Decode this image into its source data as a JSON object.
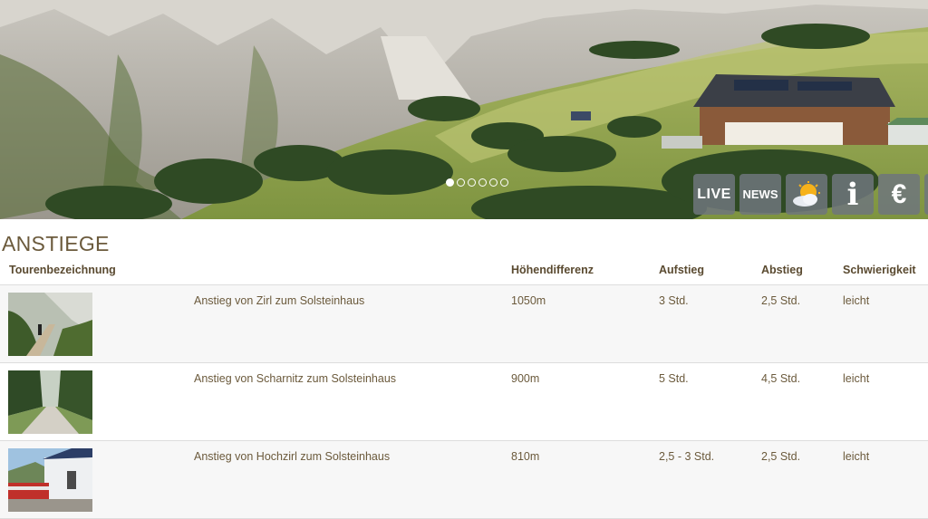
{
  "hero": {
    "slide_count": 6,
    "active_slide": 0,
    "buttons": [
      {
        "name": "live-button",
        "label": "LIVE",
        "icon": ""
      },
      {
        "name": "news-button",
        "label": "NEWS",
        "icon": ""
      },
      {
        "name": "weather-button",
        "label": "",
        "icon": "weather-sun-cloud-icon"
      },
      {
        "name": "info-button",
        "label": "i",
        "icon": "info-icon"
      },
      {
        "name": "prices-button",
        "label": "€",
        "icon": "euro-icon"
      }
    ]
  },
  "page_title": "ANSTIEGE",
  "table": {
    "headers": [
      "Tourenbezeichnung",
      "",
      "Höhendifferenz",
      "Aufstieg",
      "Abstieg",
      "Schwierigkeit"
    ],
    "rows": [
      {
        "name": "Anstieg von Zirl zum Solsteinhaus",
        "elevation": "1050m",
        "ascent": "3 Std.",
        "descent": "2,5 Std.",
        "difficulty": "leicht",
        "thumb_icon": "mountain-path-photo"
      },
      {
        "name": "Anstieg von Scharnitz zum Solsteinhaus",
        "elevation": "900m",
        "ascent": "5 Std.",
        "descent": "4,5 Std.",
        "difficulty": "leicht",
        "thumb_icon": "forest-road-photo"
      },
      {
        "name": "Anstieg von Hochzirl zum Solsteinhaus",
        "elevation": "810m",
        "ascent": "2,5 - 3 Std.",
        "descent": "2,5 Std.",
        "difficulty": "leicht",
        "thumb_icon": "train-station-photo"
      }
    ]
  }
}
